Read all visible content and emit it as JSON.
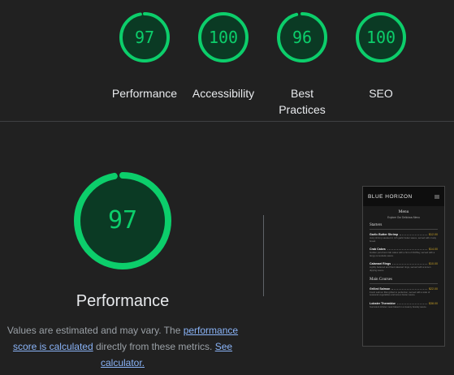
{
  "summary": {
    "gauges": [
      {
        "score": "97",
        "label": "Performance",
        "value": 97
      },
      {
        "score": "100",
        "label": "Accessibility",
        "value": 100
      },
      {
        "score": "96",
        "label": "Best Practices",
        "value": 96
      },
      {
        "score": "100",
        "label": "SEO",
        "value": 100
      }
    ]
  },
  "performance": {
    "score": "97",
    "value": 97,
    "title": "Performance",
    "note_prefix": "Values are estimated and may vary. The ",
    "note_link1": "performance score is calculated",
    "note_middle": " directly from these metrics. ",
    "note_link2": "See calculator."
  },
  "thumbnail": {
    "brand": "BLUE HORIZON",
    "menu_title": "Menu",
    "menu_sub": "Explore Our Delicious Menu",
    "sections": [
      {
        "title": "Starters",
        "items": [
          {
            "name": "Garlic Butter Shrimp",
            "price": "$12.00",
            "desc": "Juicy shrimp sautéed in rich garlic butter sauce, served with crusty bread."
          },
          {
            "name": "Crab Cakes",
            "price": "$14.00",
            "desc": "Golden pan-fried crab cakes with a hint of Old Bay, served with a tangy remoulade sauce."
          },
          {
            "name": "Calamari Rings",
            "price": "$10.00",
            "desc": "Lightly battered and fried calamari rings, served with a lemon dipping sauce."
          }
        ]
      },
      {
        "title": "Main Courses",
        "items": [
          {
            "name": "Grilled Salmon",
            "price": "$22.00",
            "desc": "Fresh salmon fillet grilled to perfection, served with a side of seasonal vegetables and lemon butter sauce."
          },
          {
            "name": "Lobster Thermidor",
            "price": "$38.00",
            "desc": "Succulent lobster meat baked in a creamy brandy sauce."
          }
        ]
      }
    ]
  },
  "colors": {
    "pass": "#0cce6b",
    "gauge_fill": "#0b3a24",
    "link": "#8ab4f8",
    "background": "#212121"
  }
}
